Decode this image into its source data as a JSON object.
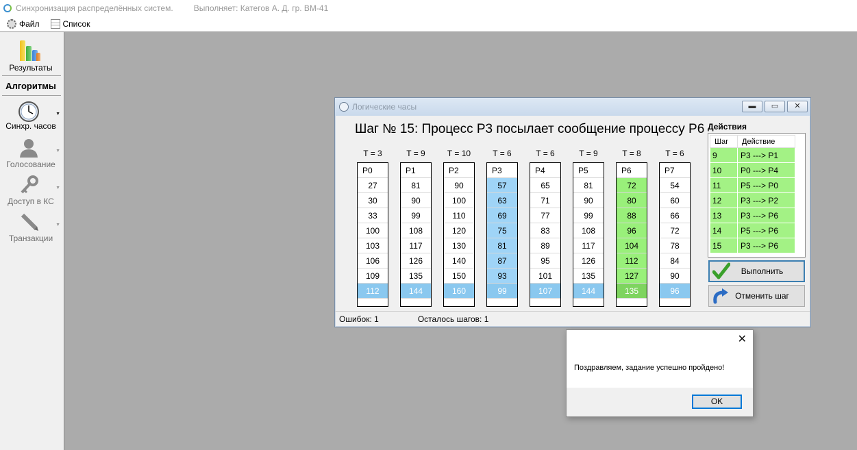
{
  "window": {
    "app_title": "Синхронизация распределённых систем.",
    "author_label": "Выполняет:  Категов А. Д.  гр. ВМ-41"
  },
  "menu": [
    "Файл",
    "Список"
  ],
  "sidebar": {
    "results_label": "Результаты",
    "section_title": "Алгоритмы",
    "items": [
      {
        "label": "Синхр. часов",
        "icon": "clock-icon",
        "enabled": true
      },
      {
        "label": "Голосование",
        "icon": "user-icon",
        "enabled": false
      },
      {
        "label": "Доступ в КС",
        "icon": "key-icon",
        "enabled": false
      },
      {
        "label": "Транзакции",
        "icon": "pencil-icon",
        "enabled": false
      }
    ]
  },
  "clock_window": {
    "title": "Логические часы",
    "step_title": "Шаг № 15: Процесс P3 посылает сообщение процессу P6",
    "actions_title": "Действия",
    "processes": [
      {
        "t": "T = 3",
        "name": "P0",
        "values": [
          "27",
          "30",
          "33",
          "100",
          "103",
          "106",
          "109",
          "112"
        ],
        "highlight": "none"
      },
      {
        "t": "T = 9",
        "name": "P1",
        "values": [
          "81",
          "90",
          "99",
          "108",
          "117",
          "126",
          "135",
          "144"
        ],
        "highlight": "none"
      },
      {
        "t": "T = 10",
        "name": "P2",
        "values": [
          "90",
          "100",
          "110",
          "120",
          "130",
          "140",
          "150",
          "160"
        ],
        "highlight": "none"
      },
      {
        "t": "T = 6",
        "name": "P3",
        "values": [
          "57",
          "63",
          "69",
          "75",
          "81",
          "87",
          "93",
          "99"
        ],
        "highlight": "blue"
      },
      {
        "t": "T = 6",
        "name": "P4",
        "values": [
          "65",
          "71",
          "77",
          "83",
          "89",
          "95",
          "101",
          "107"
        ],
        "highlight": "none"
      },
      {
        "t": "T = 9",
        "name": "P5",
        "values": [
          "81",
          "90",
          "99",
          "108",
          "117",
          "126",
          "135",
          "144"
        ],
        "highlight": "none"
      },
      {
        "t": "T = 8",
        "name": "P6",
        "values": [
          "72",
          "80",
          "88",
          "96",
          "104",
          "112",
          "127",
          "135"
        ],
        "highlight": "green"
      },
      {
        "t": "T = 6",
        "name": "P7",
        "values": [
          "54",
          "60",
          "66",
          "72",
          "78",
          "84",
          "90",
          "96"
        ],
        "highlight": "none"
      }
    ],
    "actions_table": {
      "headers": [
        "Шаг",
        "Действие"
      ],
      "rows": [
        [
          "9",
          "P3 ---> P1"
        ],
        [
          "10",
          "P0 ---> P4"
        ],
        [
          "11",
          "P5 ---> P0"
        ],
        [
          "12",
          "P3 ---> P2"
        ],
        [
          "13",
          "P3 ---> P6"
        ],
        [
          "14",
          "P5 ---> P6"
        ],
        [
          "15",
          "P3 ---> P6"
        ]
      ]
    },
    "execute_button": "Выполнить",
    "undo_button": "Отменить шаг",
    "status": {
      "errors": "Ошибок: 1",
      "remaining": "Осталось шагов: 1"
    }
  },
  "dialog": {
    "message": "Поздравляем, задание успешно пройдено!",
    "ok_label": "OK",
    "close_symbol": "✕"
  }
}
